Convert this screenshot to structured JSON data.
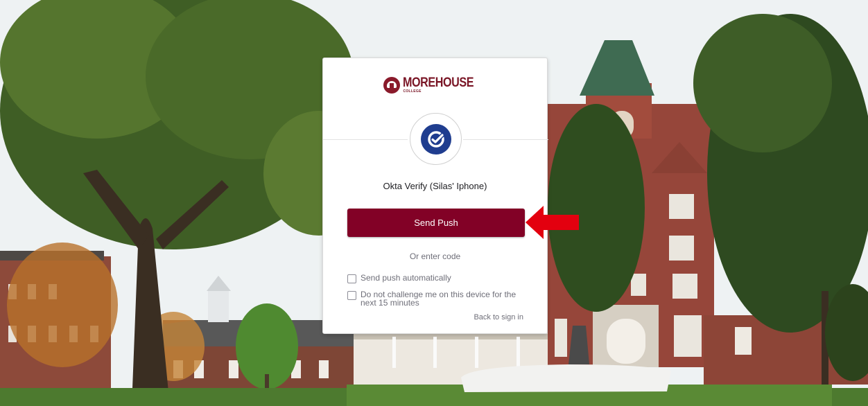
{
  "brand": {
    "name": "MOREHOUSE",
    "subtitle": "COLLEGE",
    "primary_color": "#820126",
    "factor_icon_color": "#1f3d8f"
  },
  "auth": {
    "factor_title": "Okta Verify (Silas' Iphone)",
    "send_push_label": "Send Push",
    "enter_code_label": "Or enter code",
    "send_auto_label": "Send push automatically",
    "send_auto_checked": false,
    "no_challenge_label": "Do not challenge me on this device for the next 15 minutes",
    "no_challenge_checked": false,
    "back_label": "Back to sign in"
  },
  "annotation": {
    "arrow_color": "#e3000f",
    "arrow_points_to": "send_push_button"
  },
  "icons": {
    "logo": "morehouse-seal-icon",
    "factor": "okta-verify-check-icon",
    "arrow": "red-arrow-icon"
  }
}
